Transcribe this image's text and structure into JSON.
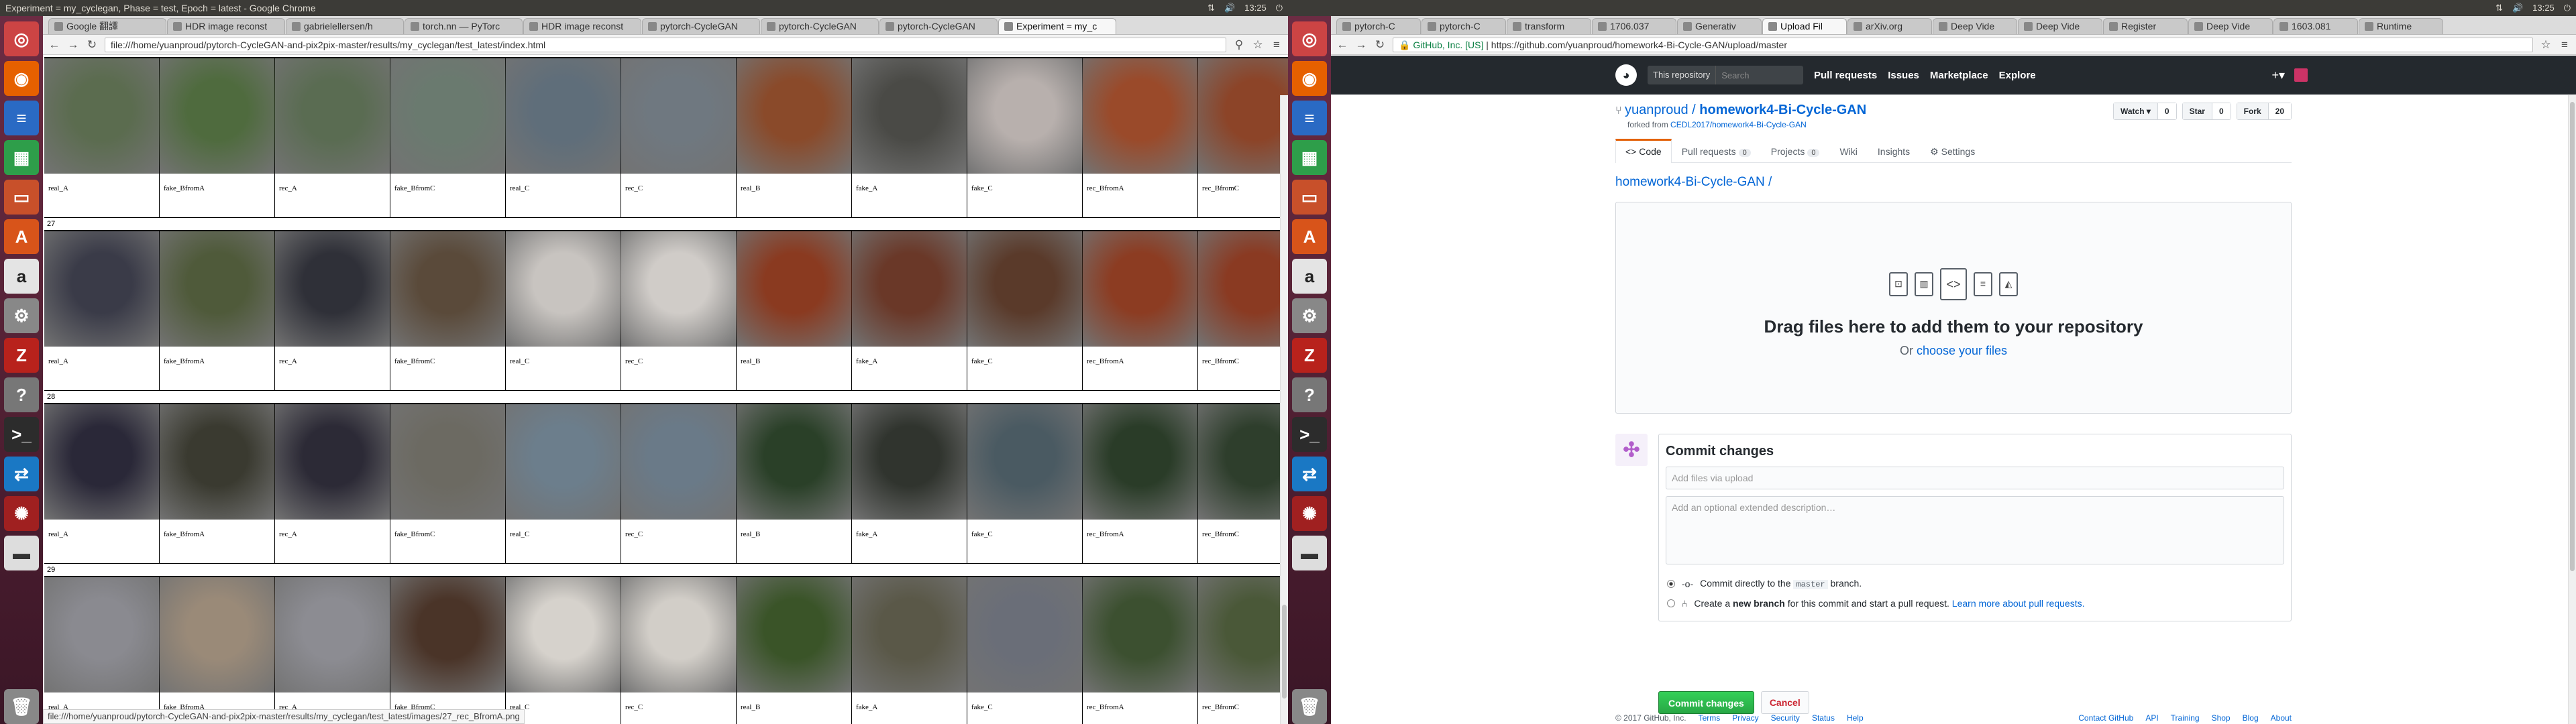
{
  "left": {
    "window_title": "Experiment = my_cyclegan, Phase = test, Epoch = latest - Google Chrome",
    "time": "13:25",
    "tabs": [
      "Google 翻譯",
      "HDR image reconst",
      "gabrielellersen/h",
      "torch.nn — PyTorc",
      "HDR image reconst",
      "pytorch-CycleGAN",
      "pytorch-CycleGAN",
      "pytorch-CycleGAN",
      "Experiment = my_c"
    ],
    "url": "file:///home/yuanproud/pytorch-CycleGAN-and-pix2pix-master/results/my_cyclegan/test_latest/index.html",
    "status": "file:///home/yuanproud/pytorch-CycleGAN-and-pix2pix-master/results/my_cyclegan/test_latest/images/27_rec_BfromA.png",
    "captions": [
      "real_A",
      "fake_BfromA",
      "rec_A",
      "fake_BfromC",
      "real_C",
      "rec_C",
      "real_B",
      "fake_A",
      "fake_C",
      "rec_BfromA",
      "rec_BfromC"
    ],
    "rows": [
      {
        "label": "",
        "colors": [
          "#5b6c4f",
          "#4f6b3e",
          "#5a6c52",
          "#6a7a6f",
          "#5f6e7a",
          "#6f7880",
          "#8a4a2a",
          "#4a4a46",
          "#b8b0ad",
          "#9a4a2a",
          "#8c4428"
        ]
      },
      {
        "label": "27",
        "colors": [
          "#3a3b48",
          "#4f5a3a",
          "#2f3038",
          "#5a4a3a",
          "#c8c4c0",
          "#d0ccc8",
          "#8a3a20",
          "#6a3828",
          "#5a3a2a",
          "#8c3c22",
          "#8a3a22"
        ]
      },
      {
        "label": "28",
        "colors": [
          "#2a2838",
          "#3a3a30",
          "#2c2a36",
          "#6c6a62",
          "#6c7e8c",
          "#6a7a88",
          "#2a4028",
          "#30342e",
          "#4a5a62",
          "#2a3c28",
          "#2e3e2c"
        ]
      },
      {
        "label": "29",
        "colors": [
          "#8a8a90",
          "#9a8a78",
          "#8c8c92",
          "#4a3428",
          "#d6d2cc",
          "#d2cec8",
          "#3a5428",
          "#5a5848",
          "#6a6e78",
          "#3c5030",
          "#4a5838"
        ]
      }
    ]
  },
  "right": {
    "time": "13:25",
    "tabs": [
      "pytorch-C",
      "pytorch-C",
      "transform",
      "1706.037",
      "Generativ",
      "Upload Fil",
      "arXiv.org",
      "Deep Vide",
      "Deep Vide",
      "Register",
      "Deep Vide",
      "1603.081",
      "Runtime"
    ],
    "url_org": "GitHub, Inc. [US]",
    "url": "https://github.com/yuanproud/homework4-Bi-Cycle-GAN/upload/master",
    "search_scope": "This repository",
    "search_placeholder": "Search",
    "nav": [
      "Pull requests",
      "Issues",
      "Marketplace",
      "Explore"
    ],
    "owner": "yuanproud",
    "repo": "homework4-Bi-Cycle-GAN",
    "forked_from_prefix": "forked from",
    "forked_from": "CEDL2017/homework4-Bi-Cycle-GAN",
    "watch": {
      "label": "Watch ▾",
      "count": "0"
    },
    "star": {
      "label": "Star",
      "count": "0"
    },
    "fork": {
      "label": "Fork",
      "count": "20"
    },
    "repo_tabs": [
      {
        "label": "Code",
        "count": ""
      },
      {
        "label": "Pull requests",
        "count": "0"
      },
      {
        "label": "Projects",
        "count": "0"
      },
      {
        "label": "Wiki",
        "count": ""
      },
      {
        "label": "Insights",
        "count": ""
      },
      {
        "label": "Settings",
        "count": ""
      }
    ],
    "breadcrumb": "homework4-Bi-Cycle-GAN /",
    "drop_title": "Drag files here to add them to your repository",
    "drop_or": "Or",
    "drop_choose": "choose your files",
    "commit_title": "Commit changes",
    "commit_placeholder": "Add files via upload",
    "desc_placeholder": "Add an optional extended description…",
    "opt1_pre": "Commit directly to the",
    "opt1_branch": "master",
    "opt1_post": "branch.",
    "opt2_pre": "Create a",
    "opt2_bold": "new branch",
    "opt2_post": "for this commit and start a pull request.",
    "opt2_link": "Learn more about pull requests.",
    "commit_button": "Commit changes",
    "cancel_button": "Cancel",
    "footer_left": [
      "© 2017 GitHub, Inc.",
      "Terms",
      "Privacy",
      "Security",
      "Status",
      "Help"
    ],
    "footer_right": [
      "Contact GitHub",
      "API",
      "Training",
      "Shop",
      "Blog",
      "About"
    ]
  }
}
